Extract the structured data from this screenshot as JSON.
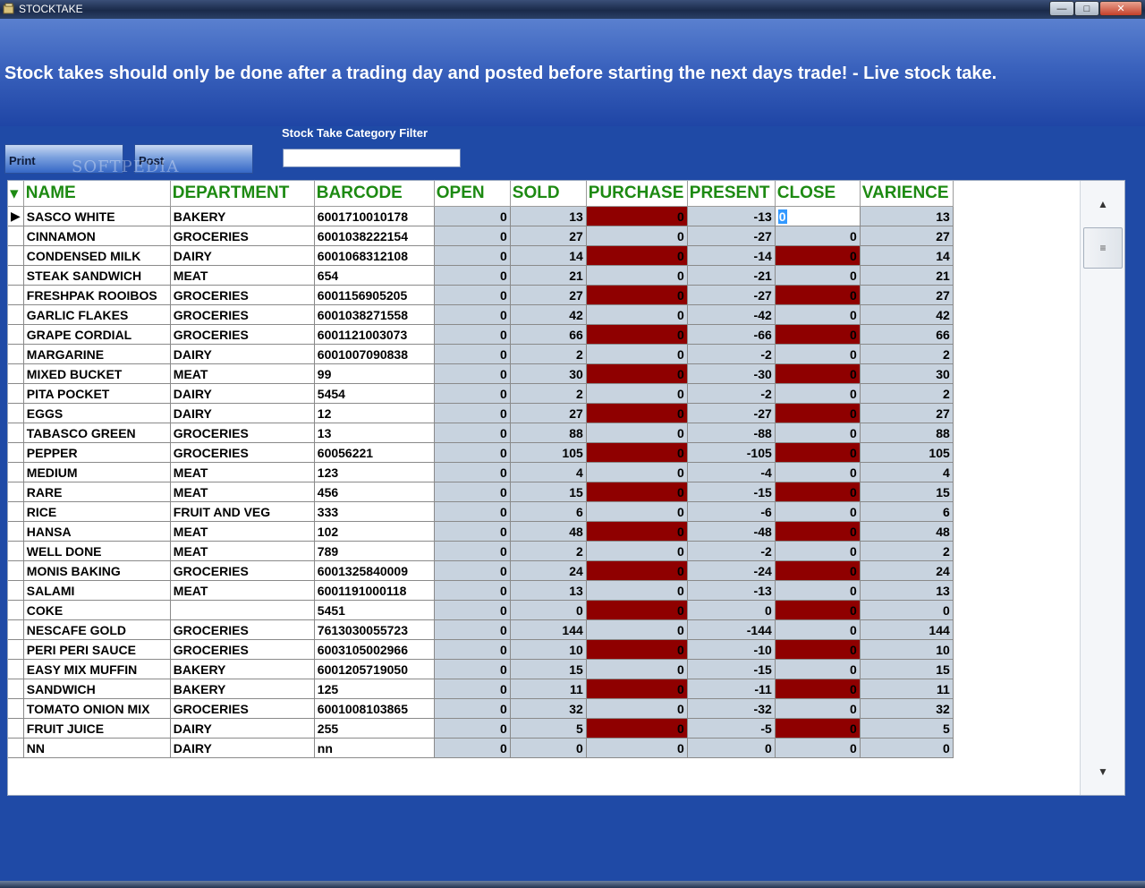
{
  "window": {
    "title": "STOCKTAKE",
    "controls": {
      "minimize": "—",
      "maximize": "□",
      "close": "✕"
    }
  },
  "banner": {
    "message": "Stock takes should only be done after a trading day and posted before starting the next days trade! - Live stock take."
  },
  "toolbar": {
    "print_label": "Print",
    "post_label": "Post",
    "filter_label": "Stock Take Category Filter",
    "filter_value": ""
  },
  "watermark": "SOFTPEDIA",
  "grid": {
    "columns": [
      "NAME",
      "DEPARTMENT",
      "BARCODE",
      "OPEN",
      "SOLD",
      "PURCHASE",
      "PRESENT",
      "CLOSE",
      "VARIENCE"
    ],
    "rows": [
      [
        "SASCO WHITE",
        "BAKERY",
        "6001710010178",
        "0",
        "13",
        "0",
        "-13",
        "0",
        "13"
      ],
      [
        "CINNAMON",
        "GROCERIES",
        "6001038222154",
        "0",
        "27",
        "0",
        "-27",
        "0",
        "27"
      ],
      [
        "CONDENSED MILK",
        "DAIRY",
        "6001068312108",
        "0",
        "14",
        "0",
        "-14",
        "0",
        "14"
      ],
      [
        "STEAK SANDWICH",
        "MEAT",
        "654",
        "0",
        "21",
        "0",
        "-21",
        "0",
        "21"
      ],
      [
        "FRESHPAK ROOIBOS",
        "GROCERIES",
        "6001156905205",
        "0",
        "27",
        "0",
        "-27",
        "0",
        "27"
      ],
      [
        "GARLIC FLAKES",
        "GROCERIES",
        "6001038271558",
        "0",
        "42",
        "0",
        "-42",
        "0",
        "42"
      ],
      [
        "GRAPE CORDIAL",
        "GROCERIES",
        "6001121003073",
        "0",
        "66",
        "0",
        "-66",
        "0",
        "66"
      ],
      [
        "MARGARINE",
        "DAIRY",
        "6001007090838",
        "0",
        "2",
        "0",
        "-2",
        "0",
        "2"
      ],
      [
        "MIXED BUCKET",
        "MEAT",
        "99",
        "0",
        "30",
        "0",
        "-30",
        "0",
        "30"
      ],
      [
        "PITA POCKET",
        "DAIRY",
        "5454",
        "0",
        "2",
        "0",
        "-2",
        "0",
        "2"
      ],
      [
        "EGGS",
        "DAIRY",
        "12",
        "0",
        "27",
        "0",
        "-27",
        "0",
        "27"
      ],
      [
        "TABASCO GREEN",
        "GROCERIES",
        "13",
        "0",
        "88",
        "0",
        "-88",
        "0",
        "88"
      ],
      [
        "PEPPER",
        "GROCERIES",
        "60056221",
        "0",
        "105",
        "0",
        "-105",
        "0",
        "105"
      ],
      [
        "MEDIUM",
        "MEAT",
        "123",
        "0",
        "4",
        "0",
        "-4",
        "0",
        "4"
      ],
      [
        "RARE",
        "MEAT",
        "456",
        "0",
        "15",
        "0",
        "-15",
        "0",
        "15"
      ],
      [
        "RICE",
        "FRUIT AND VEG",
        "333",
        "0",
        "6",
        "0",
        "-6",
        "0",
        "6"
      ],
      [
        "HANSA",
        "MEAT",
        "102",
        "0",
        "48",
        "0",
        "-48",
        "0",
        "48"
      ],
      [
        "WELL DONE",
        "MEAT",
        "789",
        "0",
        "2",
        "0",
        "-2",
        "0",
        "2"
      ],
      [
        "MONIS BAKING",
        "GROCERIES",
        "6001325840009",
        "0",
        "24",
        "0",
        "-24",
        "0",
        "24"
      ],
      [
        "SALAMI",
        "MEAT",
        "6001191000118",
        "0",
        "13",
        "0",
        "-13",
        "0",
        "13"
      ],
      [
        "COKE",
        "",
        "5451",
        "0",
        "0",
        "0",
        "0",
        "0",
        "0"
      ],
      [
        "NESCAFE GOLD",
        "GROCERIES",
        "7613030055723",
        "0",
        "144",
        "0",
        "-144",
        "0",
        "144"
      ],
      [
        "PERI PERI SAUCE",
        "GROCERIES",
        "6003105002966",
        "0",
        "10",
        "0",
        "-10",
        "0",
        "10"
      ],
      [
        "EASY MIX MUFFIN",
        "BAKERY",
        "6001205719050",
        "0",
        "15",
        "0",
        "-15",
        "0",
        "15"
      ],
      [
        "SANDWICH",
        "BAKERY",
        "125",
        "0",
        "11",
        "0",
        "-11",
        "0",
        "11"
      ],
      [
        "TOMATO ONION MIX",
        "GROCERIES",
        "6001008103865",
        "0",
        "32",
        "0",
        "-32",
        "0",
        "32"
      ],
      [
        "FRUIT JUICE",
        "DAIRY",
        "255",
        "0",
        "5",
        "0",
        "-5",
        "0",
        "5"
      ],
      [
        "NN",
        "DAIRY",
        "nn",
        "0",
        "0",
        "0",
        "0",
        "0",
        "0"
      ]
    ]
  },
  "colors": {
    "header_text": "#1d8a12",
    "highlight_cell": "#8f0000",
    "numeric_cell": "#c8d3df",
    "background": "#1f4aa6"
  }
}
